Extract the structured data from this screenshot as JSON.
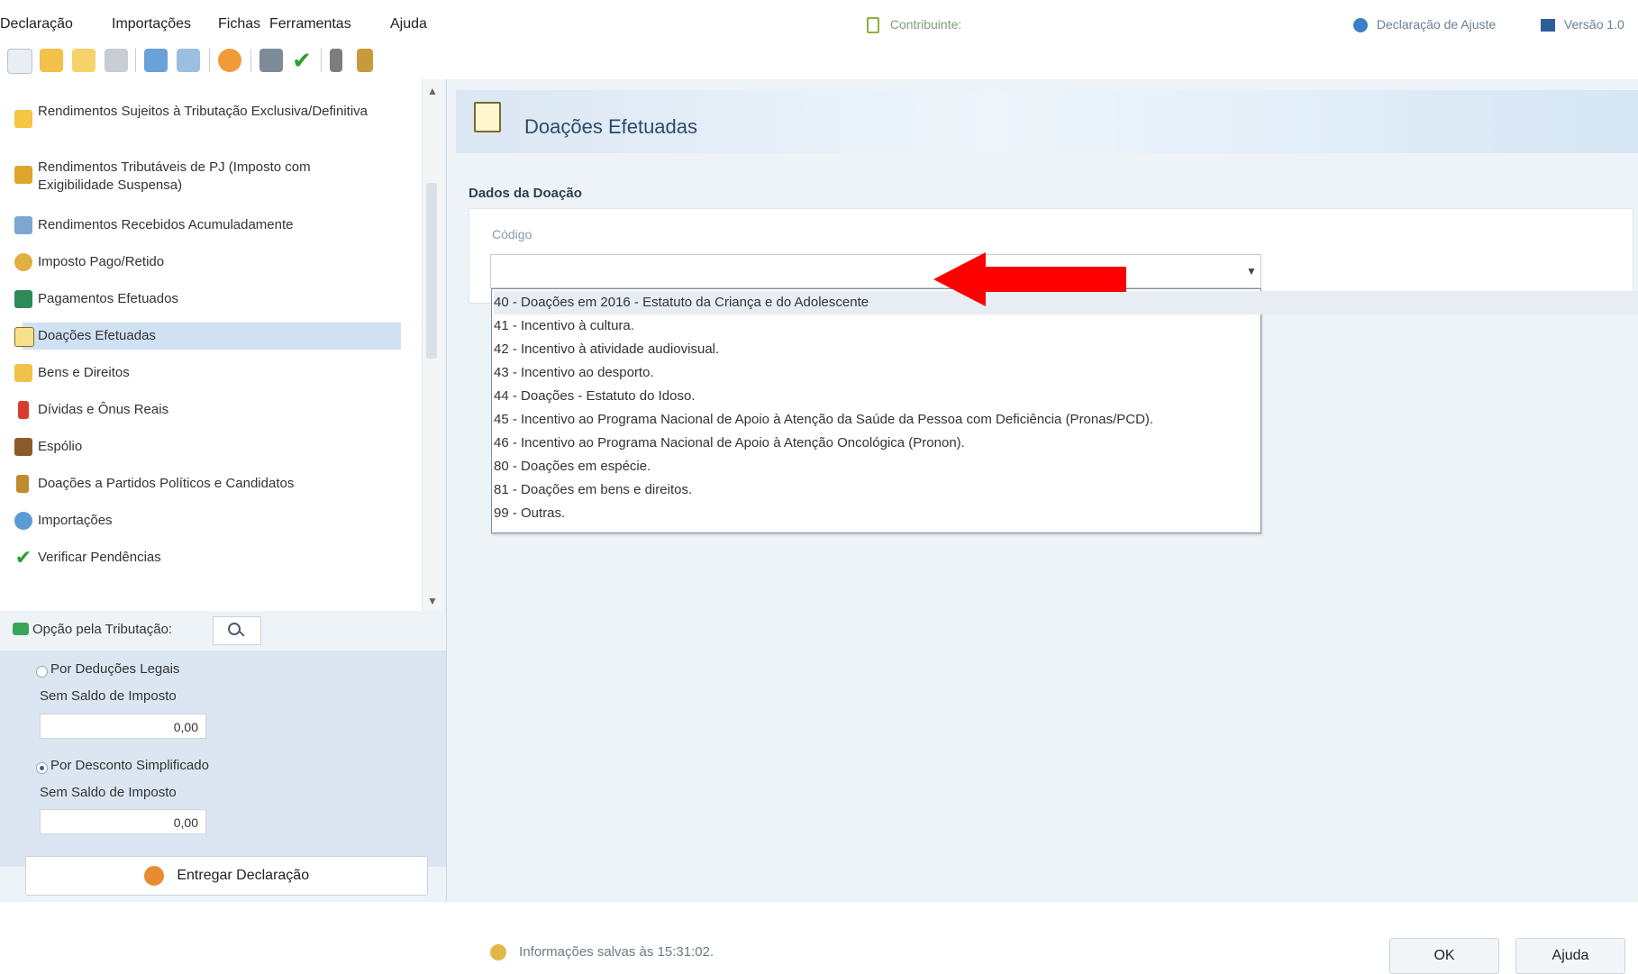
{
  "menu": [
    {
      "label": "Declaração"
    },
    {
      "label": "Importações"
    },
    {
      "label": "Fichas"
    },
    {
      "label": "Ferramentas"
    },
    {
      "label": "Ajuda"
    }
  ],
  "window": {
    "contribuinte": "Contribuinte:",
    "declaracao_ajuste": "Declaração de Ajuste",
    "versao": "Versão 1.0"
  },
  "sidebar": {
    "items": [
      {
        "label": "Rendimentos Sujeitos à Tributação Exclusiva/Definitiva"
      },
      {
        "label": "Rendimentos Tributáveis de PJ (Imposto com Exigibilidade Suspensa)"
      },
      {
        "label": "Rendimentos Recebidos Acumuladamente"
      },
      {
        "label": "Imposto Pago/Retido"
      },
      {
        "label": "Pagamentos Efetuados"
      },
      {
        "label": "Doações Efetuadas"
      },
      {
        "label": "Bens e Direitos"
      },
      {
        "label": "Dívidas e Ônus Reais"
      },
      {
        "label": "Espólio"
      },
      {
        "label": "Doações a Partidos Políticos e Candidatos"
      },
      {
        "label": "Importações"
      },
      {
        "label": "Verificar Pendências"
      }
    ],
    "option_label": "Opção pela Tributação:",
    "deducoes_label": "Por Deduções Legais",
    "deducoes_sub": "Sem Saldo de Imposto",
    "deducoes_value": "0,00",
    "desconto_label": "Por Desconto Simplificado",
    "desconto_sub": "Sem Saldo de Imposto",
    "desconto_value": "0,00",
    "entregar_label": "Entregar Declaração"
  },
  "main": {
    "title": "Doações Efetuadas",
    "section_title": "Dados da Doação",
    "codigo_label": "Código",
    "options": [
      "40 - Doações em 2016 - Estatuto da Criança e do Adolescente",
      "41 - Incentivo à cultura.",
      "42 - Incentivo à atividade audiovisual.",
      "43 - Incentivo ao desporto.",
      "44 - Doações - Estatuto do Idoso.",
      "45 - Incentivo ao Programa Nacional de Apoio à Atenção da Saúde da Pessoa com Deficiência (Pronas/PCD).",
      "46 - Incentivo ao Programa Nacional de Apoio à Atenção Oncológica (Pronon).",
      "80 - Doações em espécie.",
      "81 - Doações em bens e direitos.",
      "99 - Outras."
    ],
    "status": "Informações salvas às 15:31:02.",
    "ok_label": "OK",
    "ajuda_label": "Ajuda"
  }
}
